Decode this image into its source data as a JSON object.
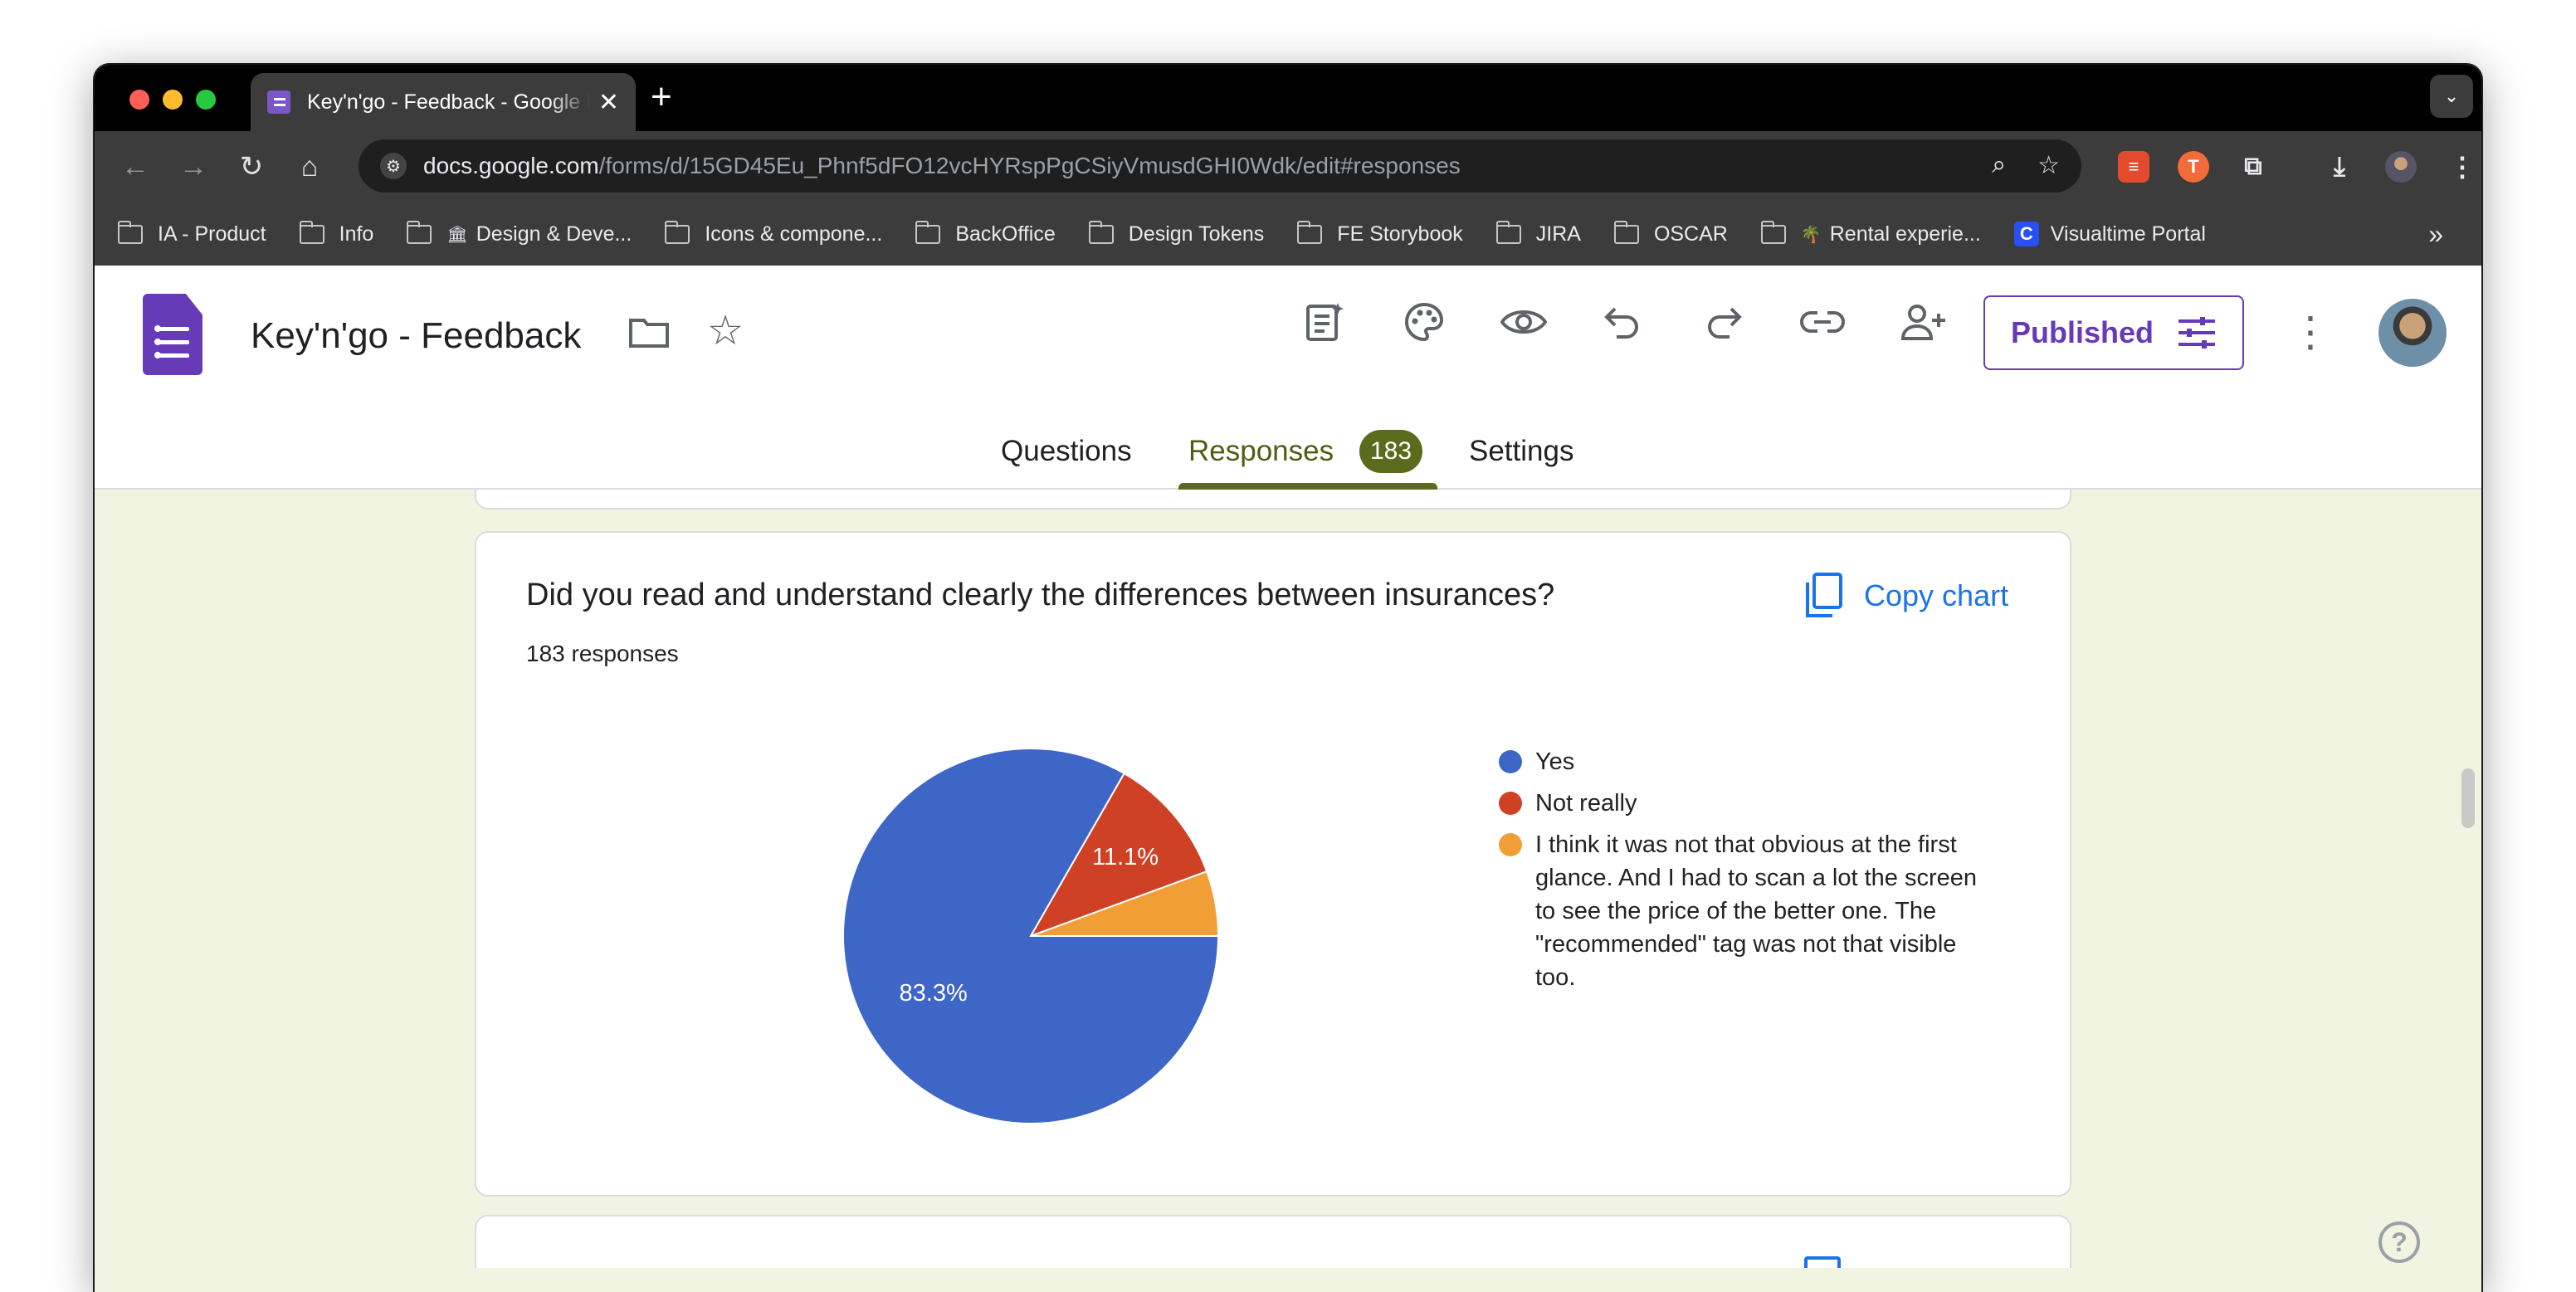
{
  "browser": {
    "tab_title": "Key'n'go - Feedback - Google Forms",
    "tab_close": "✕",
    "new_tab": "+",
    "url_host": "docs.google.com",
    "url_path": "/forms/d/15GD45Eu_Phnf5dFO12vcHYRspPgCSiyVmusdGHI0Wdk/edit#responses",
    "bookmarks": [
      {
        "label": "IA - Product",
        "type": "folder"
      },
      {
        "label": "Info",
        "type": "folder"
      },
      {
        "label": "Design & Deve...",
        "type": "folder",
        "emoji": "🏛"
      },
      {
        "label": "Icons & compone...",
        "type": "folder"
      },
      {
        "label": "BackOffice",
        "type": "folder"
      },
      {
        "label": "Design Tokens",
        "type": "folder"
      },
      {
        "label": "FE Storybook",
        "type": "folder"
      },
      {
        "label": "JIRA",
        "type": "folder"
      },
      {
        "label": "OSCAR",
        "type": "folder"
      },
      {
        "label": "Rental experie...",
        "type": "folder",
        "emoji": "🌴"
      },
      {
        "label": "Visualtime Portal",
        "type": "site"
      }
    ],
    "bookmarks_overflow": "»"
  },
  "header": {
    "form_title": "Key'n'go - Feedback",
    "published_label": "Published",
    "tabs": {
      "questions": "Questions",
      "responses": "Responses",
      "responses_count": "183",
      "settings": "Settings"
    }
  },
  "card": {
    "question": "Did you read and understand clearly the differences between insurances?",
    "responses": "183 responses",
    "copy_chart": "Copy chart"
  },
  "colors": {
    "yes": "#3e66c6",
    "not_really": "#cf4124",
    "other": "#f19e36",
    "forms_purple": "#673ab7",
    "accent_green": "#5b6b1e"
  },
  "chart_data": {
    "type": "pie",
    "title": "Did you read and understand clearly the differences between insurances?",
    "series": [
      {
        "name": "Yes",
        "value": 83.3,
        "color": "#3e66c6",
        "label": "83.3%"
      },
      {
        "name": "Not really",
        "value": 11.1,
        "color": "#cf4124",
        "label": "11.1%"
      },
      {
        "name": "I think it was not that obvious at the first glance. And I had to scan a lot the screen to see the price of the better one. The \"recommended\" tag was not that visible too.",
        "value": 5.6,
        "color": "#f19e36",
        "label": ""
      }
    ],
    "legend_position": "right"
  }
}
